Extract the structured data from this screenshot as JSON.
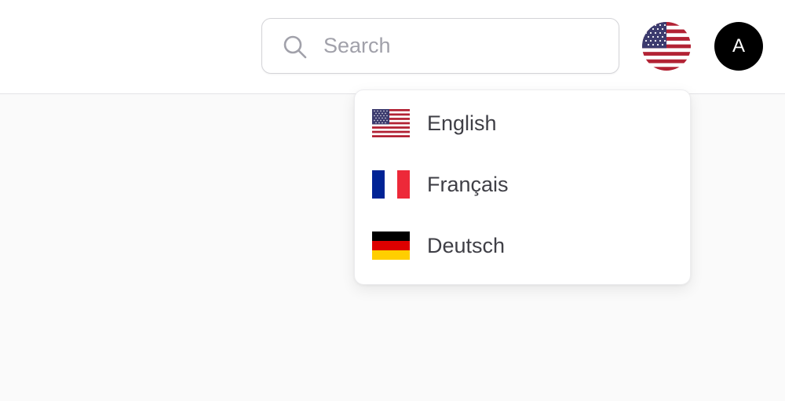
{
  "search": {
    "placeholder": "Search",
    "icon": "search-icon"
  },
  "language_button": {
    "current": "English",
    "icon": "us-flag-icon"
  },
  "avatar": {
    "initial": "A"
  },
  "language_menu": {
    "items": [
      {
        "label": "English",
        "icon": "us-flag-icon"
      },
      {
        "label": "Français",
        "icon": "fr-flag-icon"
      },
      {
        "label": "Deutsch",
        "icon": "de-flag-icon"
      }
    ]
  },
  "colors": {
    "us_red": "#b22234",
    "us_blue": "#3c3b6e",
    "fr_blue": "#002395",
    "fr_red": "#ed2939",
    "de_black": "#000000",
    "de_red": "#dd0000",
    "de_gold": "#ffce00"
  }
}
